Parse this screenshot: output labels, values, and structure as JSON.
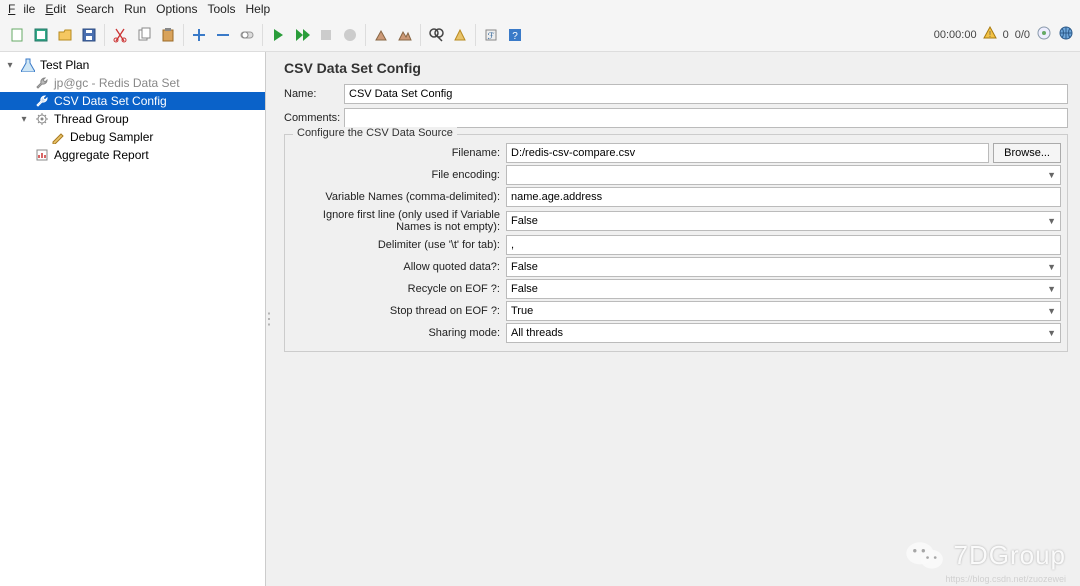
{
  "menu": {
    "file": "File",
    "edit": "Edit",
    "search": "Search",
    "run": "Run",
    "options": "Options",
    "tools": "Tools",
    "help": "Help"
  },
  "toolbar_right": {
    "time": "00:00:00",
    "warn": "0",
    "stats": "0/0"
  },
  "tree": {
    "root": "Test Plan",
    "redis": "jp@gc - Redis Data Set",
    "csv": "CSV Data Set Config",
    "thread": "Thread Group",
    "debug": "Debug Sampler",
    "agg": "Aggregate Report"
  },
  "panel": {
    "title": "CSV Data Set Config",
    "name_label": "Name:",
    "name_value": "CSV Data Set Config",
    "comments_label": "Comments:",
    "comments_value": "",
    "fieldset_legend": "Configure the CSV Data Source",
    "rows": {
      "filename": {
        "label": "Filename:",
        "value": "D:/redis-csv-compare.csv",
        "browse": "Browse..."
      },
      "encoding": {
        "label": "File encoding:",
        "value": ""
      },
      "varnames": {
        "label": "Variable Names (comma-delimited):",
        "value": "name.age.address"
      },
      "ignore": {
        "label": "Ignore first line (only used if Variable Names is not empty):",
        "value": "False"
      },
      "delimiter": {
        "label": "Delimiter (use '\\t' for tab):",
        "value": ","
      },
      "quoted": {
        "label": "Allow quoted data?:",
        "value": "False"
      },
      "recycle": {
        "label": "Recycle on EOF ?:",
        "value": "False"
      },
      "stop": {
        "label": "Stop thread on EOF ?:",
        "value": "True"
      },
      "sharing": {
        "label": "Sharing mode:",
        "value": "All threads"
      }
    }
  },
  "watermark": {
    "text": "7DGroup",
    "sub": "https://blog.csdn.net/zuozewei"
  }
}
